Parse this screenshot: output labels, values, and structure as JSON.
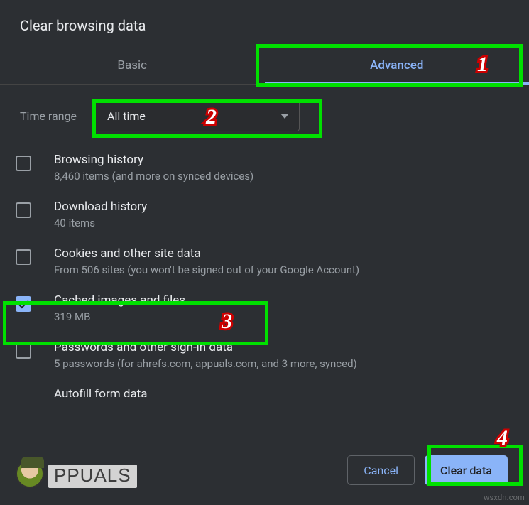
{
  "title": "Clear browsing data",
  "tabs": {
    "basic": "Basic",
    "advanced": "Advanced"
  },
  "time": {
    "label": "Time range",
    "value": "All time"
  },
  "options": [
    {
      "title": "Browsing history",
      "sub": "8,460 items (and more on synced devices)",
      "checked": false
    },
    {
      "title": "Download history",
      "sub": "40 items",
      "checked": false
    },
    {
      "title": "Cookies and other site data",
      "sub": "From 506 sites (you won't be signed out of your Google Account)",
      "checked": false
    },
    {
      "title": "Cached images and files",
      "sub": "319 MB",
      "checked": true
    },
    {
      "title": "Passwords and other sign-in data",
      "sub": "5 passwords (for ahrefs.com, appuals.com, and 3 more, synced)",
      "checked": false
    },
    {
      "title": "Autofill form data",
      "sub": "",
      "checked": false
    }
  ],
  "buttons": {
    "cancel": "Cancel",
    "clear": "Clear data"
  },
  "annotations": {
    "1": "1",
    "2": "2",
    "3": "3",
    "4": "4"
  },
  "brand": "PPUALS",
  "watermark": "wsxdn.com"
}
